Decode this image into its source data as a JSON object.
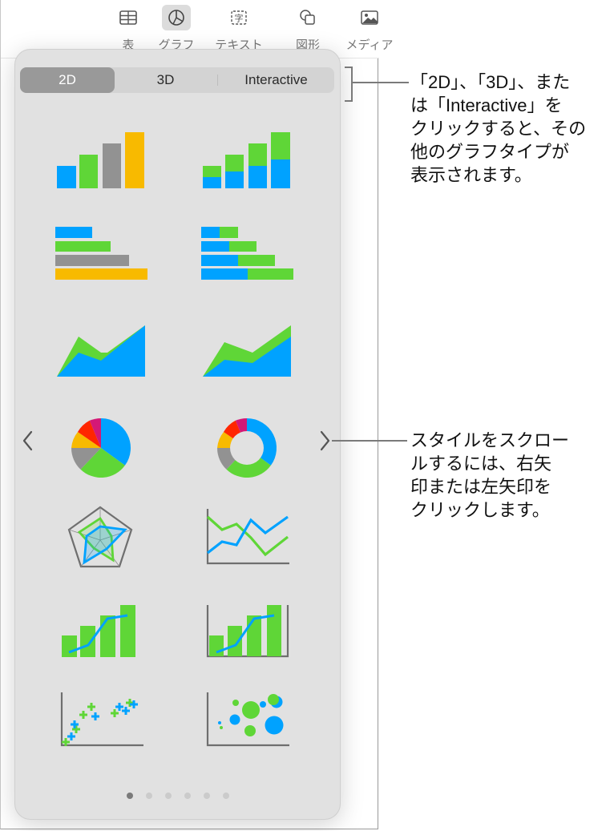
{
  "toolbar": {
    "items": [
      {
        "label": "表",
        "icon": "table-icon",
        "active": false
      },
      {
        "label": "グラフ",
        "icon": "chart-icon",
        "active": true
      },
      {
        "label": "テキスト",
        "icon": "text-icon",
        "active": false
      },
      {
        "label": "図形",
        "icon": "shape-icon",
        "active": false
      },
      {
        "label": "メディア",
        "icon": "media-icon",
        "active": false
      }
    ]
  },
  "chart_picker": {
    "tabs": [
      {
        "label": "2D",
        "selected": true
      },
      {
        "label": "3D",
        "selected": false
      },
      {
        "label": "Interactive",
        "selected": false
      }
    ],
    "chart_types": [
      "column",
      "stacked-column",
      "bar",
      "stacked-bar",
      "area",
      "stacked-area",
      "pie",
      "donut",
      "radar",
      "line",
      "mixed",
      "two-axis",
      "scatter",
      "bubble"
    ],
    "colors": {
      "blue": "#00a2ff",
      "green": "#5fd637",
      "gray": "#929292",
      "yellow": "#f8ba00",
      "red": "#ff2600",
      "magenta": "#d41876"
    },
    "page_count": 6,
    "current_page": 1,
    "prev_icon": "chevron-left-icon",
    "next_icon": "chevron-right-icon"
  },
  "callouts": {
    "tabs_note": [
      "「2D」、「3D」、また",
      "は「Interactive」を",
      "クリックすると、その",
      "他のグラフタイプが",
      "表示されます。"
    ],
    "arrows_note": [
      "スタイルをスクロー",
      "ルするには、右矢",
      "印または左矢印を",
      "クリックします。"
    ]
  }
}
